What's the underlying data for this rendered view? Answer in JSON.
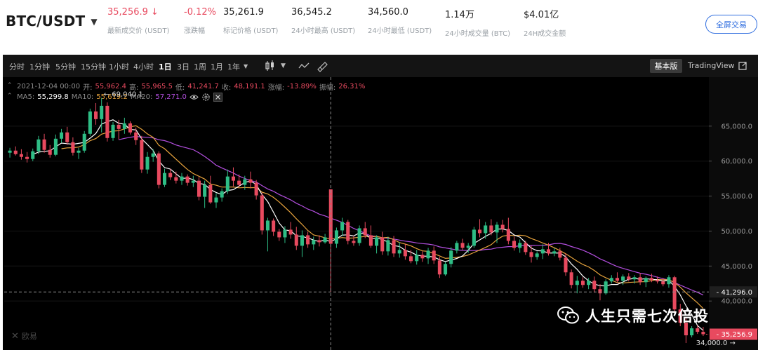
{
  "ticker": {
    "pair": "BTC/USDT",
    "stats": [
      {
        "value": "35,256.9 ↓",
        "label": "最新成交价 (USDT)",
        "tone": "down"
      },
      {
        "value": "-0.12%",
        "label": "涨跌幅",
        "tone": "down"
      },
      {
        "value": "35,261.9",
        "label": "标记价格 (USDT)",
        "tone": "normal"
      },
      {
        "value": "36,545.2",
        "label": "24小时最高 (USDT)",
        "tone": "normal"
      },
      {
        "value": "34,560.0",
        "label": "24小时最低 (USDT)",
        "tone": "normal"
      },
      {
        "value": "1.14万",
        "label": "24小时成交量 (BTC)",
        "tone": "normal"
      },
      {
        "value": "$4.01亿",
        "label": "24H成交金额",
        "tone": "normal"
      }
    ],
    "fullscreen_label": "全屏交易"
  },
  "toolbar": {
    "timeframes": [
      "分时",
      "1分钟",
      "5分钟",
      "15分钟",
      "1小时",
      "4小时",
      "1日",
      "3日",
      "1周",
      "1月",
      "1年"
    ],
    "active_timeframe": "1日",
    "views": {
      "basic": "基本版",
      "tradingview": "TradingView"
    }
  },
  "legend": {
    "date": "2021-12-04 00:00",
    "open_label": "开:",
    "open": "55,962.4",
    "high_label": "高:",
    "high": "55,965.5",
    "low_label": "低:",
    "low": "41,241.7",
    "close_label": "收:",
    "close": "48,191.1",
    "change_label": "涨幅:",
    "change": "-13.89%",
    "amplitude_label": "振幅:",
    "amplitude": "26.31%",
    "ma5_label": "MA5:",
    "ma5": "55,299.8",
    "ma10_label": "MA10:",
    "ma10": "55,619.2",
    "ma20_label": "MA20:",
    "ma20": "57,271.0"
  },
  "watermarks": {
    "exchange": "欧易",
    "wechat": "人生只需七次倍投"
  },
  "colors": {
    "up": "#2ebd85",
    "down": "#e84a5f",
    "ma5": "#ffffff",
    "ma10": "#e6a23c",
    "ma20": "#b44fe0",
    "accent": "#2d6cdf"
  },
  "chart_data": {
    "type": "candlestick",
    "y_axis": {
      "ticks": [
        40000,
        45000,
        50000,
        55000,
        60000,
        65000
      ],
      "tick_labels": [
        "40,000.0",
        "45,000.0",
        "50,000.0",
        "55,000.0",
        "60,000.0",
        "65,000.0"
      ],
      "range": [
        33000,
        72000
      ]
    },
    "annotations": {
      "high_marker": {
        "label": "69,040.1",
        "value": 69040.1,
        "index": 16
      },
      "low_marker": {
        "label": "34,000.0",
        "value": 34000,
        "index": 127
      },
      "crosshair_price": {
        "label": "41,296.0",
        "value": 41296
      },
      "last_price": {
        "label": "35,256.9",
        "value": 35256.9
      }
    },
    "crosshair_index": 56,
    "candles": [
      [
        61200,
        61900,
        60500,
        61500
      ],
      [
        61500,
        62100,
        60800,
        61000
      ],
      [
        61000,
        61700,
        60200,
        60600
      ],
      [
        60600,
        61300,
        59800,
        60300
      ],
      [
        60300,
        61800,
        60000,
        61400
      ],
      [
        61400,
        63600,
        61000,
        63100
      ],
      [
        63100,
        63900,
        61200,
        61600
      ],
      [
        61600,
        62300,
        60500,
        60900
      ],
      [
        60900,
        63800,
        60700,
        63200
      ],
      [
        63200,
        64600,
        62600,
        64100
      ],
      [
        64100,
        64900,
        62300,
        62700
      ],
      [
        62700,
        63400,
        60800,
        61200
      ],
      [
        61200,
        61900,
        60300,
        61500
      ],
      [
        61500,
        64300,
        61200,
        63900
      ],
      [
        63900,
        67500,
        63600,
        67100
      ],
      [
        67100,
        68300,
        65200,
        66000
      ],
      [
        66000,
        69040,
        64100,
        67900
      ],
      [
        67900,
        68400,
        62800,
        63300
      ],
      [
        63300,
        65600,
        62900,
        65200
      ],
      [
        65200,
        65900,
        63100,
        64600
      ],
      [
        64600,
        66200,
        63900,
        65400
      ],
      [
        65400,
        65700,
        63800,
        64100
      ],
      [
        64100,
        64800,
        62300,
        63000
      ],
      [
        63000,
        63600,
        58300,
        58800
      ],
      [
        58800,
        61300,
        58200,
        60600
      ],
      [
        60600,
        61700,
        59900,
        61100
      ],
      [
        61100,
        61400,
        56100,
        56600
      ],
      [
        56600,
        58900,
        56300,
        58300
      ],
      [
        58300,
        58900,
        57300,
        57700
      ],
      [
        57700,
        58500,
        56800,
        57200
      ],
      [
        57200,
        58300,
        56600,
        57800
      ],
      [
        57800,
        58100,
        56500,
        56900
      ],
      [
        56900,
        57900,
        56300,
        57200
      ],
      [
        57200,
        57700,
        54400,
        54900
      ],
      [
        54900,
        57200,
        53300,
        56600
      ],
      [
        56600,
        57900,
        53900,
        54100
      ],
      [
        54100,
        55400,
        53300,
        54800
      ],
      [
        54800,
        56100,
        54200,
        55700
      ],
      [
        55700,
        58800,
        55300,
        57800
      ],
      [
        57800,
        59100,
        56400,
        57200
      ],
      [
        57200,
        58100,
        56300,
        56600
      ],
      [
        56600,
        57900,
        55900,
        57400
      ],
      [
        57400,
        58500,
        56100,
        56900
      ],
      [
        56900,
        57300,
        54500,
        55100
      ],
      [
        55100,
        55500,
        49500,
        50100
      ],
      [
        50100,
        51900,
        47100,
        51500
      ],
      [
        51500,
        51800,
        49300,
        49900
      ],
      [
        49900,
        50300,
        48600,
        49100
      ],
      [
        49100,
        50700,
        48300,
        50200
      ],
      [
        50200,
        51300,
        48900,
        49500
      ],
      [
        49500,
        50600,
        47300,
        47900
      ],
      [
        47900,
        50100,
        46300,
        49400
      ],
      [
        49400,
        49900,
        47600,
        48100
      ],
      [
        48100,
        49200,
        47300,
        48700
      ],
      [
        48700,
        49400,
        47800,
        48400
      ],
      [
        48400,
        49600,
        48200,
        49100
      ],
      [
        55962,
        55965,
        41242,
        48191
      ],
      [
        48191,
        50500,
        47600,
        50100
      ],
      [
        50100,
        51900,
        49300,
        51300
      ],
      [
        51300,
        51600,
        48100,
        48600
      ],
      [
        48600,
        49300,
        47900,
        48300
      ],
      [
        48300,
        50800,
        47900,
        50400
      ],
      [
        50400,
        51300,
        49000,
        49400
      ],
      [
        49400,
        50800,
        47600,
        47900
      ],
      [
        47900,
        49400,
        46800,
        49100
      ],
      [
        49100,
        49900,
        46600,
        47100
      ],
      [
        47100,
        49200,
        46500,
        48700
      ],
      [
        48700,
        49300,
        46300,
        46800
      ],
      [
        46800,
        48400,
        46200,
        47300
      ],
      [
        47300,
        48200,
        45900,
        46400
      ],
      [
        46400,
        47300,
        45400,
        45700
      ],
      [
        45700,
        47300,
        45200,
        46600
      ],
      [
        46600,
        47100,
        45600,
        46100
      ],
      [
        46100,
        47600,
        45300,
        47200
      ],
      [
        47200,
        47800,
        45300,
        45800
      ],
      [
        45800,
        46300,
        43300,
        43800
      ],
      [
        43800,
        45600,
        43600,
        45300
      ],
      [
        45300,
        47700,
        44800,
        47200
      ],
      [
        47200,
        48600,
        46800,
        48300
      ],
      [
        48300,
        48900,
        47300,
        47600
      ],
      [
        47600,
        48300,
        46900,
        47900
      ],
      [
        47900,
        50600,
        47600,
        50200
      ],
      [
        50200,
        51700,
        49100,
        49700
      ],
      [
        49700,
        51300,
        48900,
        50800
      ],
      [
        50800,
        51700,
        49400,
        49800
      ],
      [
        49800,
        51300,
        48300,
        50900
      ],
      [
        50900,
        51600,
        49800,
        50300
      ],
      [
        50300,
        51900,
        48100,
        48600
      ],
      [
        48600,
        49200,
        47200,
        47600
      ],
      [
        47600,
        48800,
        46900,
        48300
      ],
      [
        48300,
        48600,
        46600,
        47000
      ],
      [
        47000,
        47900,
        45500,
        46300
      ],
      [
        46300,
        47100,
        45900,
        46800
      ],
      [
        46800,
        48100,
        46000,
        47400
      ],
      [
        47400,
        48300,
        46500,
        46800
      ],
      [
        46800,
        47600,
        46400,
        47100
      ],
      [
        47100,
        47600,
        45800,
        46200
      ],
      [
        46200,
        46800,
        43600,
        44100
      ],
      [
        44100,
        44500,
        41800,
        42300
      ],
      [
        42300,
        43600,
        41100,
        42900
      ],
      [
        42900,
        43400,
        41900,
        42300
      ],
      [
        42300,
        43300,
        41700,
        42900
      ],
      [
        42900,
        43500,
        41200,
        41700
      ],
      [
        41700,
        42400,
        40100,
        41100
      ],
      [
        41100,
        43100,
        40900,
        42800
      ],
      [
        42800,
        43700,
        42500,
        43300
      ],
      [
        43300,
        44100,
        42600,
        42900
      ],
      [
        42900,
        43800,
        42300,
        43500
      ],
      [
        43500,
        44000,
        42800,
        43100
      ],
      [
        43100,
        43700,
        42500,
        43400
      ],
      [
        43400,
        44000,
        42300,
        42700
      ],
      [
        42700,
        43500,
        42000,
        43300
      ],
      [
        43300,
        43900,
        42700,
        43000
      ],
      [
        43000,
        43500,
        42500,
        42800
      ],
      [
        42800,
        43300,
        42100,
        42400
      ],
      [
        42400,
        43700,
        41900,
        43400
      ],
      [
        43400,
        43600,
        38300,
        38800
      ],
      [
        38800,
        39600,
        36400,
        36900
      ],
      [
        36900,
        37500,
        34000,
        35100
      ],
      [
        35100,
        36400,
        34800,
        36100
      ],
      [
        36100,
        36500,
        35300,
        35600
      ],
      [
        35600,
        36300,
        35000,
        35257
      ]
    ]
  }
}
